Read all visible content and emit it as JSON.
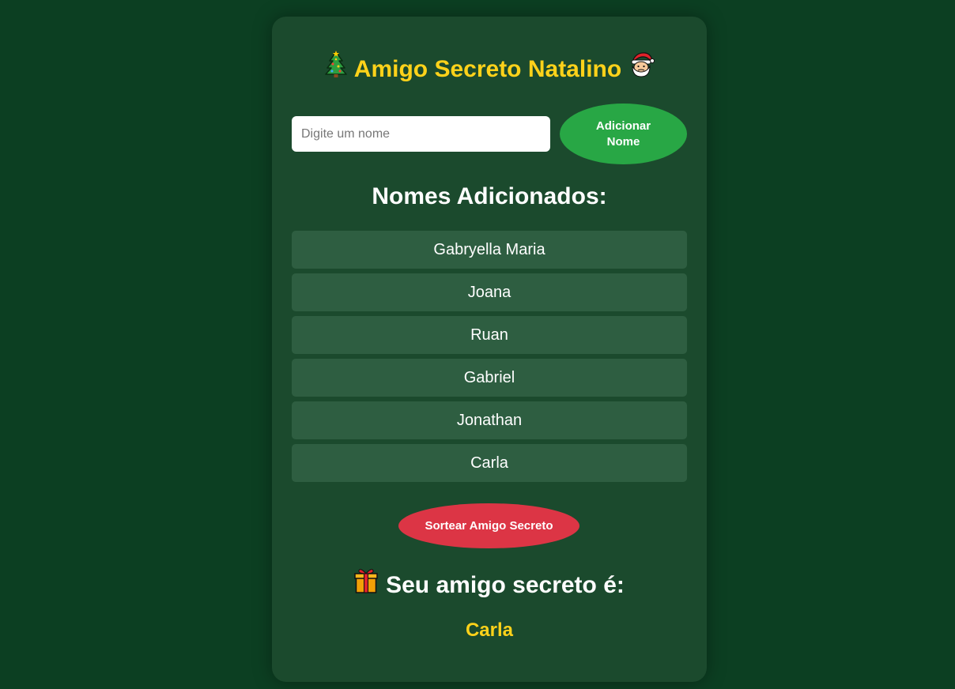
{
  "app": {
    "title": "Amigo Secreto Natalino",
    "title_left_icon": "christmas-tree-icon",
    "title_right_icon": "santa-icon"
  },
  "form": {
    "input_value": "",
    "input_placeholder": "Digite um nome",
    "add_button_label": "Adicionar Nome"
  },
  "names_section": {
    "heading": "Nomes Adicionados:",
    "items": [
      {
        "label": "Gabryella Maria"
      },
      {
        "label": "Joana"
      },
      {
        "label": "Ruan"
      },
      {
        "label": "Gabriel"
      },
      {
        "label": "Jonathan"
      },
      {
        "label": "Carla"
      }
    ]
  },
  "draw_button": {
    "label": "Sortear Amigo Secreto"
  },
  "result": {
    "icon": "gift-icon",
    "heading": "Seu amigo secreto é:",
    "name": "Carla"
  },
  "colors": {
    "page_background": "#0c3f22",
    "card_background": "#1b4a2d",
    "list_item_background": "#2e5e41",
    "accent_yellow": "#ffd21a",
    "add_button": "#28a745",
    "draw_button": "#dc3545"
  }
}
